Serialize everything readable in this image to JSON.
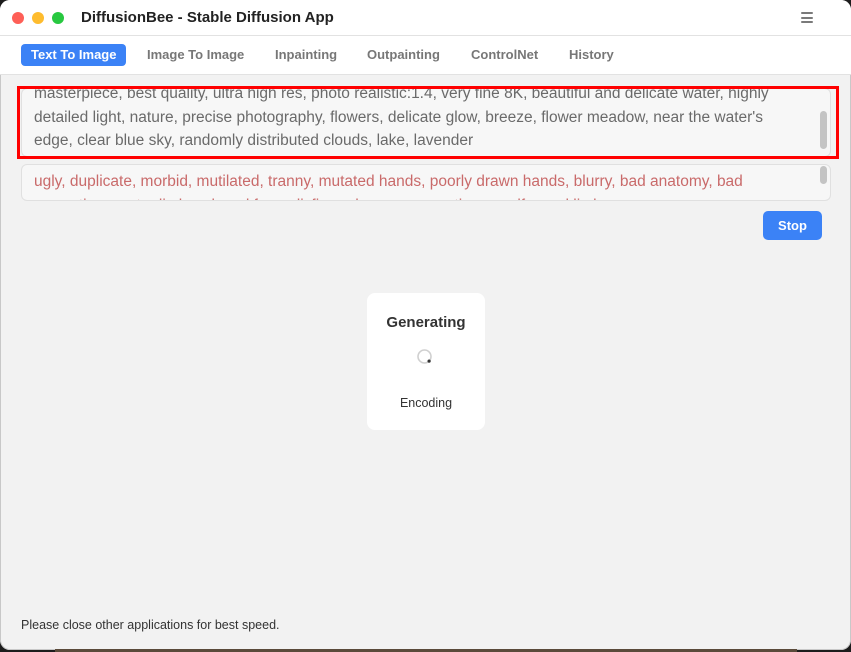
{
  "window": {
    "title": "DiffusionBee - Stable Diffusion App"
  },
  "tabs": [
    {
      "label": "Text To Image",
      "active": true
    },
    {
      "label": "Image To Image",
      "active": false
    },
    {
      "label": "Inpainting",
      "active": false
    },
    {
      "label": "Outpainting",
      "active": false
    },
    {
      "label": "ControlNet",
      "active": false
    },
    {
      "label": "History",
      "active": false
    }
  ],
  "prompt": {
    "value": "masterpiece, best quality, ultra high res, photo realistic:1.4, very fine 8K, beautiful and delicate water, highly detailed light, nature, precise photography, flowers, delicate glow, breeze, flower meadow, near the water's edge, clear blue sky, randomly distributed clouds, lake, lavender"
  },
  "negative_prompt": {
    "value": "ugly, duplicate, morbid, mutilated, tranny, mutated hands, poorly drawn hands, blurry, bad anatomy, bad proportions, extra limbs, cloned face, disfigured, gross proportions, malformed limbs"
  },
  "controls": {
    "stop_label": "Stop"
  },
  "generation": {
    "title": "Generating",
    "status": "Encoding"
  },
  "footer": {
    "note": "Please close other applications for best speed."
  },
  "colors": {
    "accent": "#3b82f6",
    "highlight": "#ff0000",
    "negative_text": "#c96a6a"
  }
}
